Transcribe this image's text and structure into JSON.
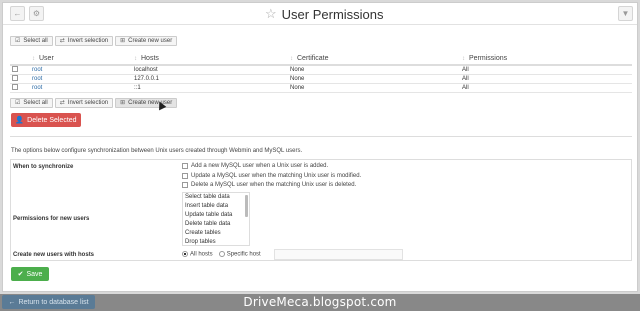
{
  "header": {
    "title": "User Permissions",
    "back_icon": "arrow-left-icon",
    "settings_icon": "gear-icon",
    "filter_icon": "filter-icon"
  },
  "toolbar": {
    "select_all": "Select all",
    "invert_selection": "Invert selection",
    "create_new_user": "Create new user"
  },
  "table": {
    "columns": [
      "User",
      "Hosts",
      "Certificate",
      "Permissions"
    ],
    "rows": [
      {
        "user": "root",
        "host": "localhost",
        "certificate": "None",
        "permissions": "All"
      },
      {
        "user": "root",
        "host": "127.0.0.1",
        "certificate": "None",
        "permissions": "All"
      },
      {
        "user": "root",
        "host": "::1",
        "certificate": "None",
        "permissions": "All"
      }
    ]
  },
  "delete_selected": "Delete Selected",
  "sync_description": "The options below configure synchronization between Unix users created through Webmin and MySQL users.",
  "form": {
    "when_to_sync_label": "When to synchronize",
    "sync_options": [
      "Add a new MySQL user when a Unix user is added.",
      "Update a MySQL user when the matching Unix user is modified.",
      "Delete a MySQL user when the matching Unix user is deleted."
    ],
    "permissions_label": "Permissions for new users",
    "permissions_options": [
      "Select table data",
      "Insert table data",
      "Update table data",
      "Delete table data",
      "Create tables",
      "Drop tables"
    ],
    "hosts_label": "Create new users with hosts",
    "all_hosts": "All hosts",
    "specific_host": "Specific host"
  },
  "save": "Save",
  "return_link": "Return to database list",
  "watermark": "DriveMeca.blogspot.com",
  "colors": {
    "danger": "#d9534f",
    "success": "#4cae4c",
    "link": "#2b6aa5"
  }
}
